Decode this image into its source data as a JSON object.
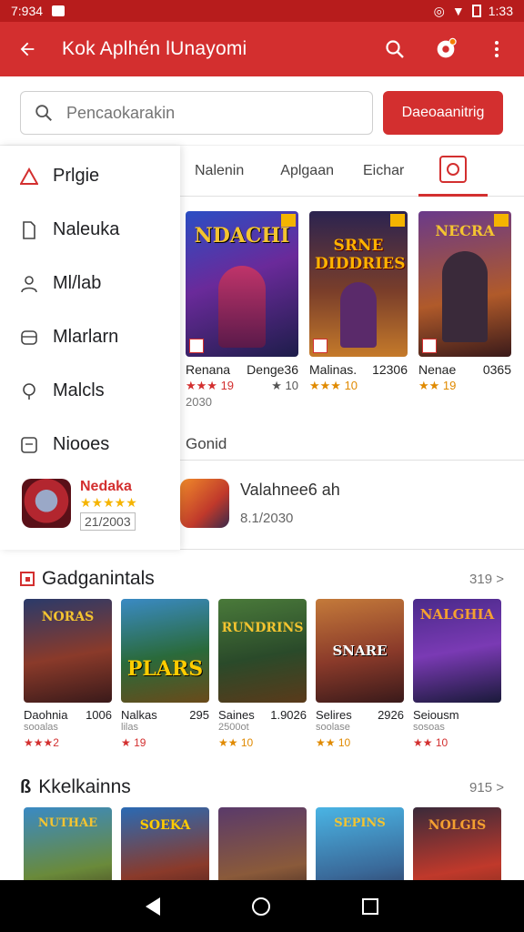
{
  "status": {
    "time": "7:934",
    "clock": "1:33"
  },
  "appbar": {
    "title": "Kok Aplhén lUnayomi"
  },
  "search": {
    "placeholder": "Pencaokarakin",
    "button": "Daeoaanitrig"
  },
  "drawer": {
    "items": [
      {
        "label": "Prlgie",
        "icon": "warning-icon"
      },
      {
        "label": "Naleuka",
        "icon": "file-icon"
      },
      {
        "label": "Ml/lab",
        "icon": "person-icon"
      },
      {
        "label": "Mlarlarn",
        "icon": "box-icon"
      },
      {
        "label": "Malcls",
        "icon": "pin-icon"
      },
      {
        "label": "Niooes",
        "icon": "card-icon"
      }
    ],
    "feature": {
      "name": "Nedaka",
      "stars": "★★★★★",
      "date": "21/2003"
    }
  },
  "tabs": [
    "Nalenin",
    "Aplgaan",
    "Eichar"
  ],
  "top_cards": [
    {
      "cover_text": "NDACHI",
      "name": "Renana",
      "extra": "Denge36",
      "rating": "★★★ 19",
      "rating2": "★ 10",
      "sub": "2030"
    },
    {
      "cover_text": "SRNE DIDDRIES",
      "name": "Malinas.",
      "extra": "12306",
      "rating": "★★★ 10",
      "rating2": "",
      "sub": ""
    },
    {
      "cover_text": "NECRA",
      "name": "Nenae",
      "extra": "0365",
      "rating": "★★ 19",
      "rating2": "",
      "sub": ""
    }
  ],
  "section_label": "Gonid",
  "list_item": {
    "name": "Valahnee6 ah",
    "date": "8.1/2030"
  },
  "sections": [
    {
      "title": "Gadganintals",
      "more": "319 >",
      "items": [
        {
          "cover": "NORAS",
          "name": "Daohnia",
          "extra": "1006",
          "sub": "sooalas",
          "rating": "★★★2"
        },
        {
          "cover": "PLARS",
          "name": "Nalkas",
          "extra": "295",
          "sub": "lilas",
          "rating": "★ 19"
        },
        {
          "cover": "RUNDRINS",
          "name": "Saines",
          "extra": "1.9026",
          "sub": "2500ot",
          "rating": "★★ 10"
        },
        {
          "cover": "SNARE",
          "name": "Selires",
          "extra": "2926",
          "sub": "soolase",
          "rating": "★★ 10"
        },
        {
          "cover": "NALGHIA",
          "name": "Seiousm",
          "extra": "",
          "sub": "sosoas",
          "rating": "★★ 10"
        }
      ]
    },
    {
      "title": "Kkelkainns",
      "more": "915 >",
      "items": [
        {
          "cover": "NUTHAE"
        },
        {
          "cover": "SOEKA"
        },
        {
          "cover": ""
        },
        {
          "cover": "SEPINS"
        },
        {
          "cover": "NOLGIS"
        }
      ]
    }
  ],
  "colors": {
    "primary": "#d32f2f",
    "accent": "#f4b400"
  }
}
